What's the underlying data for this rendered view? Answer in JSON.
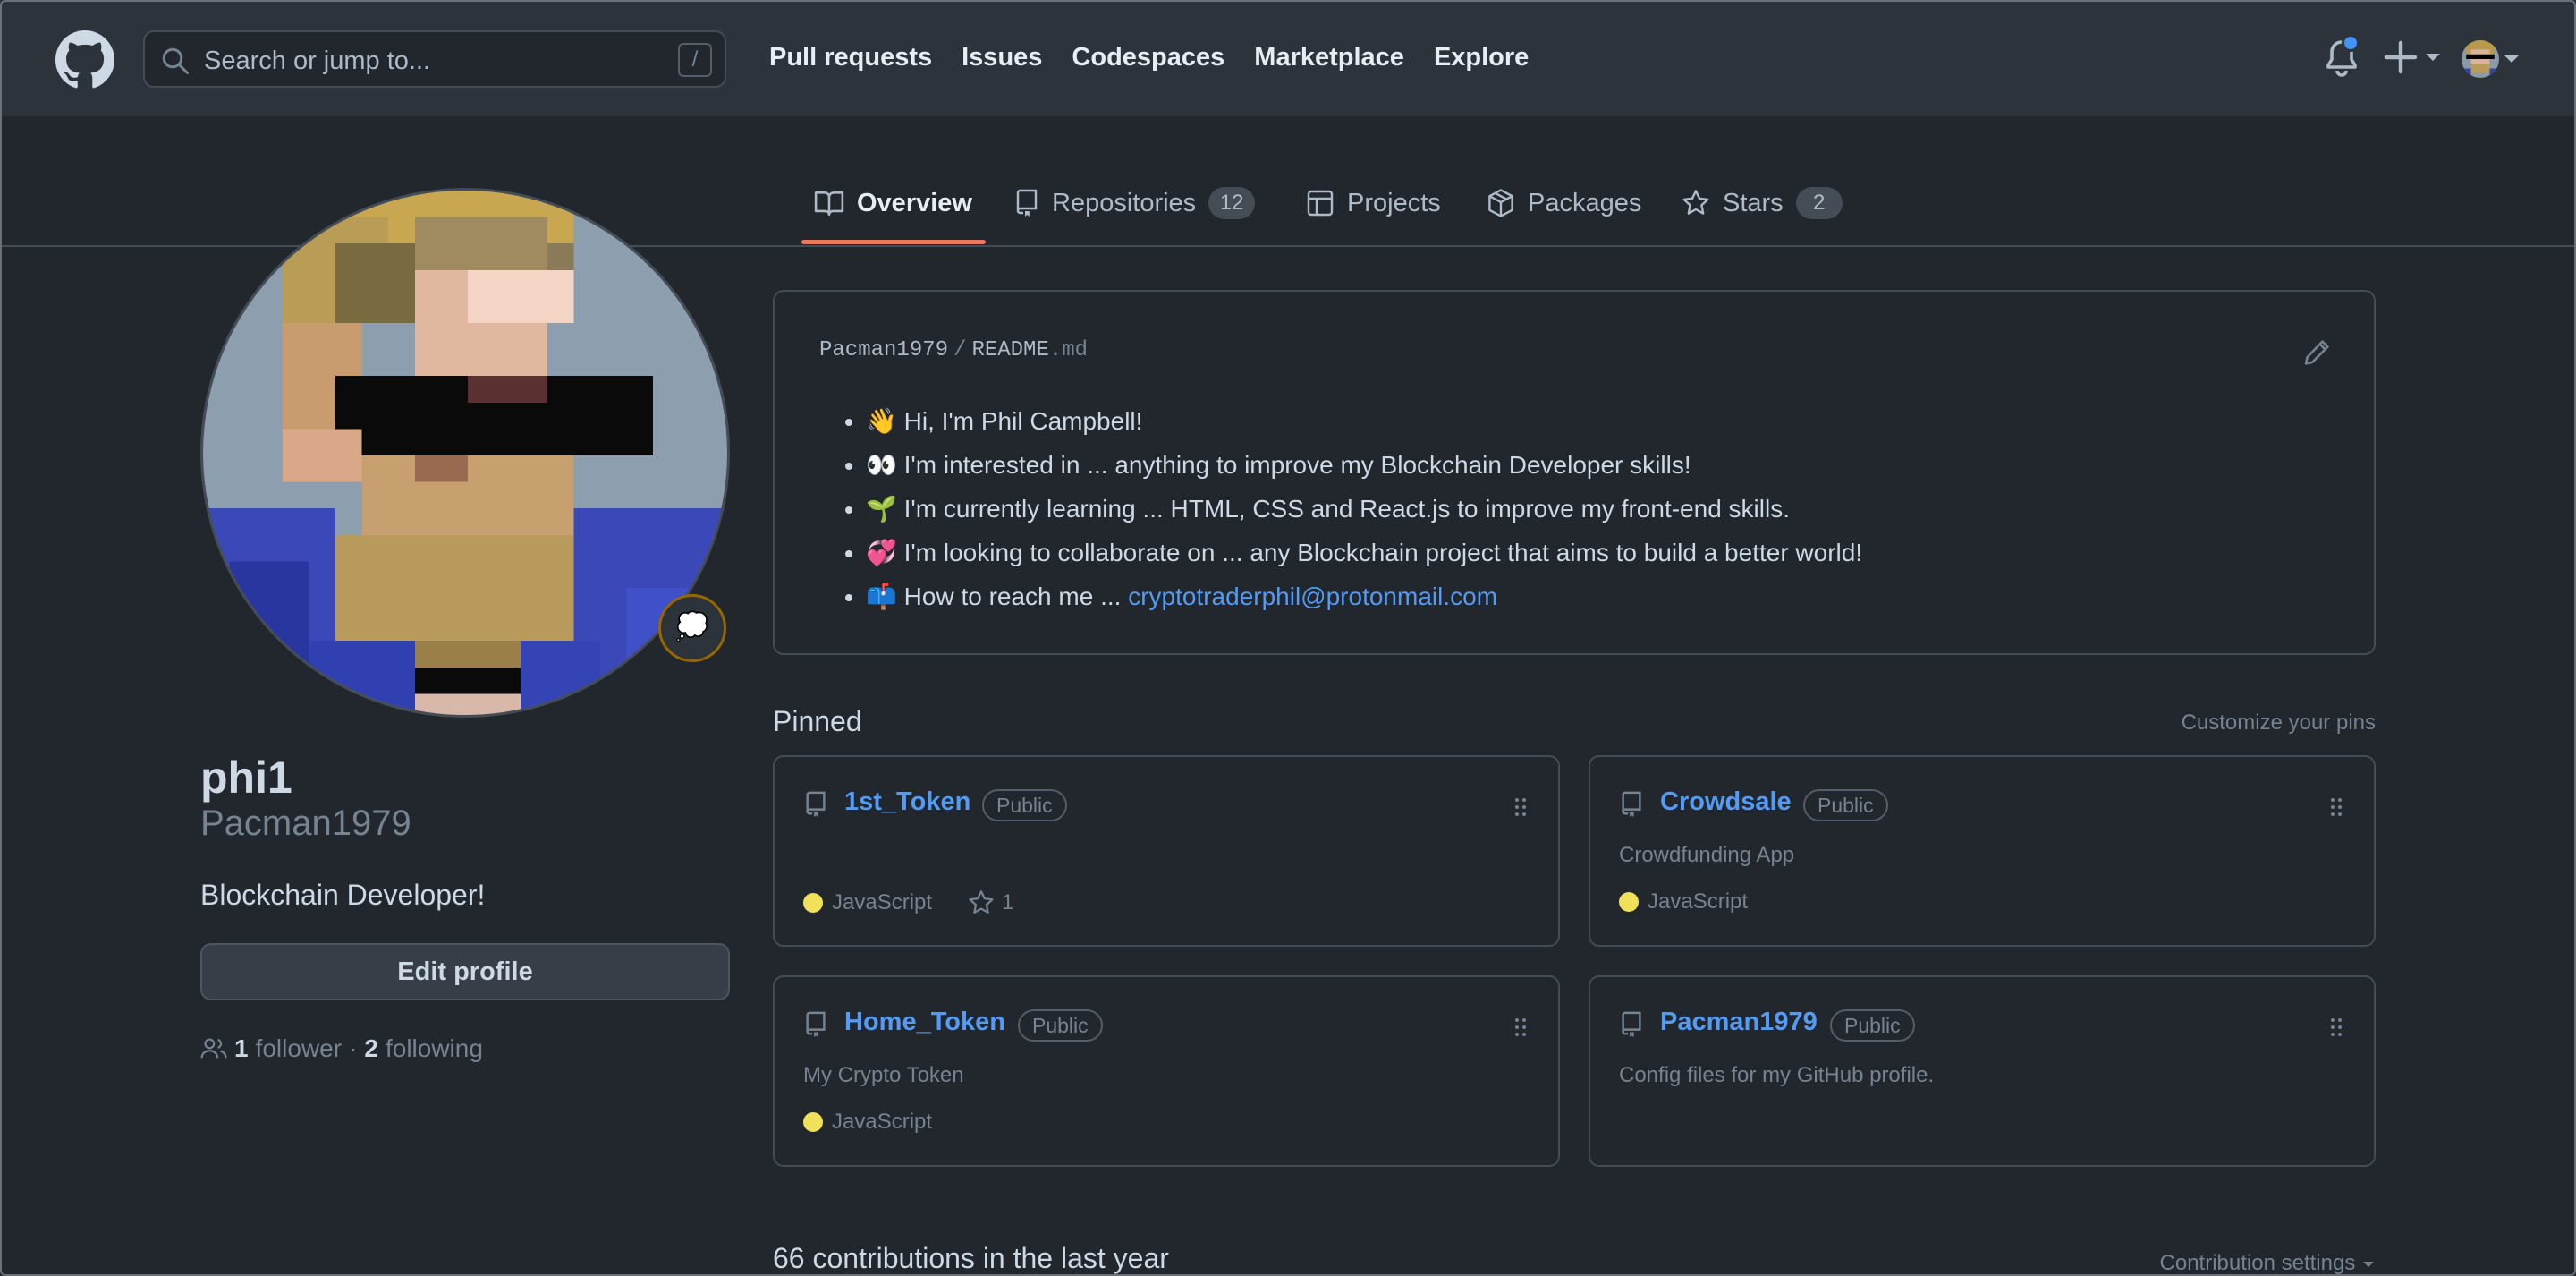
{
  "header": {
    "search_placeholder": "Search or jump to...",
    "search_shortcut": "/",
    "nav": [
      "Pull requests",
      "Issues",
      "Codespaces",
      "Marketplace",
      "Explore"
    ],
    "icons": [
      "github-logo-icon",
      "bell-icon",
      "plus-icon",
      "caret-down-icon"
    ]
  },
  "tabs": [
    {
      "label": "Overview",
      "active": true,
      "icon": "book-icon"
    },
    {
      "label": "Repositories",
      "count": "12",
      "icon": "repo-icon"
    },
    {
      "label": "Projects",
      "icon": "table-icon"
    },
    {
      "label": "Packages",
      "icon": "package-icon"
    },
    {
      "label": "Stars",
      "count": "2",
      "icon": "star-icon"
    }
  ],
  "profile": {
    "name": "phi1",
    "username": "Pacman1979",
    "bio": "Blockchain Developer!",
    "status_emoji": "💭",
    "edit_label": "Edit profile",
    "followers": "1",
    "followers_label": "follower",
    "separator": "·",
    "following": "2",
    "following_label": "following"
  },
  "readme": {
    "owner": "Pacman1979",
    "sep": "/",
    "file_base": "README",
    "file_ext": ".md",
    "lines": [
      {
        "emoji": "👋",
        "text": "Hi, I'm Phil Campbell!"
      },
      {
        "emoji": "👀",
        "text": "I'm interested in ... anything to improve my Blockchain Developer skills!"
      },
      {
        "emoji": "🌱",
        "text": "I'm currently learning ... HTML, CSS and React.js to improve my front-end skills."
      },
      {
        "emoji": "💞️",
        "text": "I'm looking to collaborate on ... any Blockchain project that aims to build a better world!"
      },
      {
        "emoji": "📫",
        "text": "How to reach me ... ",
        "link": "cryptotraderphil@protonmail.com"
      }
    ]
  },
  "pinned": {
    "title": "Pinned",
    "customize": "Customize your pins",
    "cards": [
      {
        "name": "1st_Token",
        "visibility": "Public",
        "description": "",
        "language": "JavaScript",
        "stars": "1",
        "lang_color": "#f1e05a"
      },
      {
        "name": "Crowdsale",
        "visibility": "Public",
        "description": "Crowdfunding App",
        "language": "JavaScript",
        "lang_color": "#f1e05a"
      },
      {
        "name": "Home_Token",
        "visibility": "Public",
        "description": "My Crypto Token",
        "language": "JavaScript",
        "lang_color": "#f1e05a"
      },
      {
        "name": "Pacman1979",
        "visibility": "Public",
        "description": "Config files for my GitHub profile.",
        "language": ""
      }
    ]
  },
  "contributions": {
    "title": "66 contributions in the last year",
    "settings": "Contribution settings"
  },
  "colors": {
    "background": "#22272e",
    "header": "#2d333b",
    "link": "#539bf5",
    "tab_accent": "#ec775c",
    "notification": "#4493f8"
  }
}
